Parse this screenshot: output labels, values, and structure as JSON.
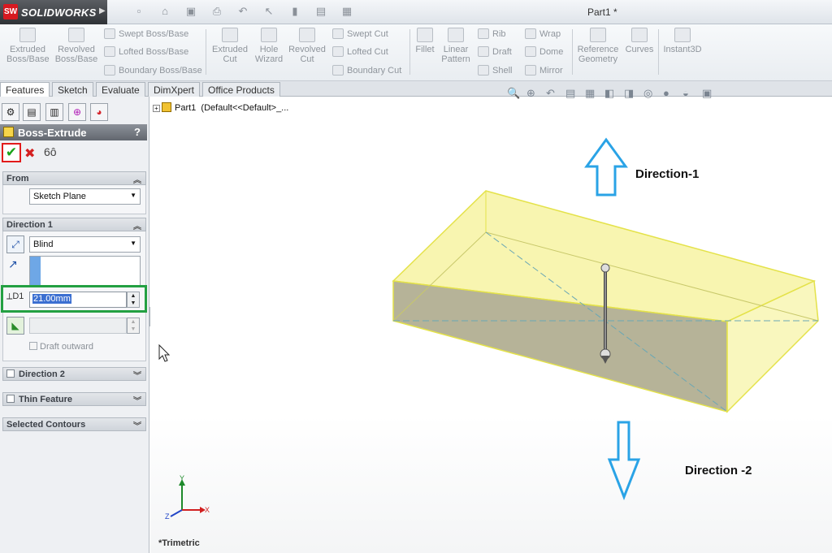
{
  "app": {
    "logo_mark": "SW",
    "name": "SOLIDWORKS",
    "doc_title": "Part1 *"
  },
  "ribbon": {
    "extruded_boss": "Extruded Boss/Base",
    "revolved_boss": "Revolved Boss/Base",
    "swept_boss": "Swept Boss/Base",
    "lofted_boss": "Lofted Boss/Base",
    "boundary_boss": "Boundary Boss/Base",
    "extruded_cut": "Extruded Cut",
    "hole_wizard": "Hole Wizard",
    "revolved_cut": "Revolved Cut",
    "swept_cut": "Swept Cut",
    "lofted_cut": "Lofted Cut",
    "boundary_cut": "Boundary Cut",
    "fillet": "Fillet",
    "linear_pattern": "Linear Pattern",
    "rib": "Rib",
    "draft": "Draft",
    "shell": "Shell",
    "wrap": "Wrap",
    "dome": "Dome",
    "mirror": "Mirror",
    "reference_geometry": "Reference Geometry",
    "curves": "Curves",
    "instant3d": "Instant3D"
  },
  "tabs": [
    "Features",
    "Sketch",
    "Evaluate",
    "DimXpert",
    "Office Products"
  ],
  "panel": {
    "title": "Boss-Extrude",
    "help": "?",
    "from_label": "From",
    "from_value": "Sketch Plane",
    "direction1_label": "Direction 1",
    "end_condition": "Blind",
    "depth": "21.00mm",
    "draft_outward": "Draft outward",
    "direction2_label": "Direction 2",
    "thin_feature_label": "Thin Feature",
    "selected_contours_label": "Selected Contours"
  },
  "tree": {
    "part": "Part1",
    "config": "(Default<<Default>_..."
  },
  "viewport": {
    "direction1": "Direction-1",
    "direction2": "Direction -2",
    "view_name": "*Trimetric",
    "axis_y": "Y",
    "axis_x": "X",
    "axis_z": "Z"
  },
  "colors": {
    "highlight_ok": "#e21b1b",
    "highlight_depth": "#23a042",
    "arrow_blue": "#2aa3e6",
    "body_yellow": "#f5f08a"
  }
}
